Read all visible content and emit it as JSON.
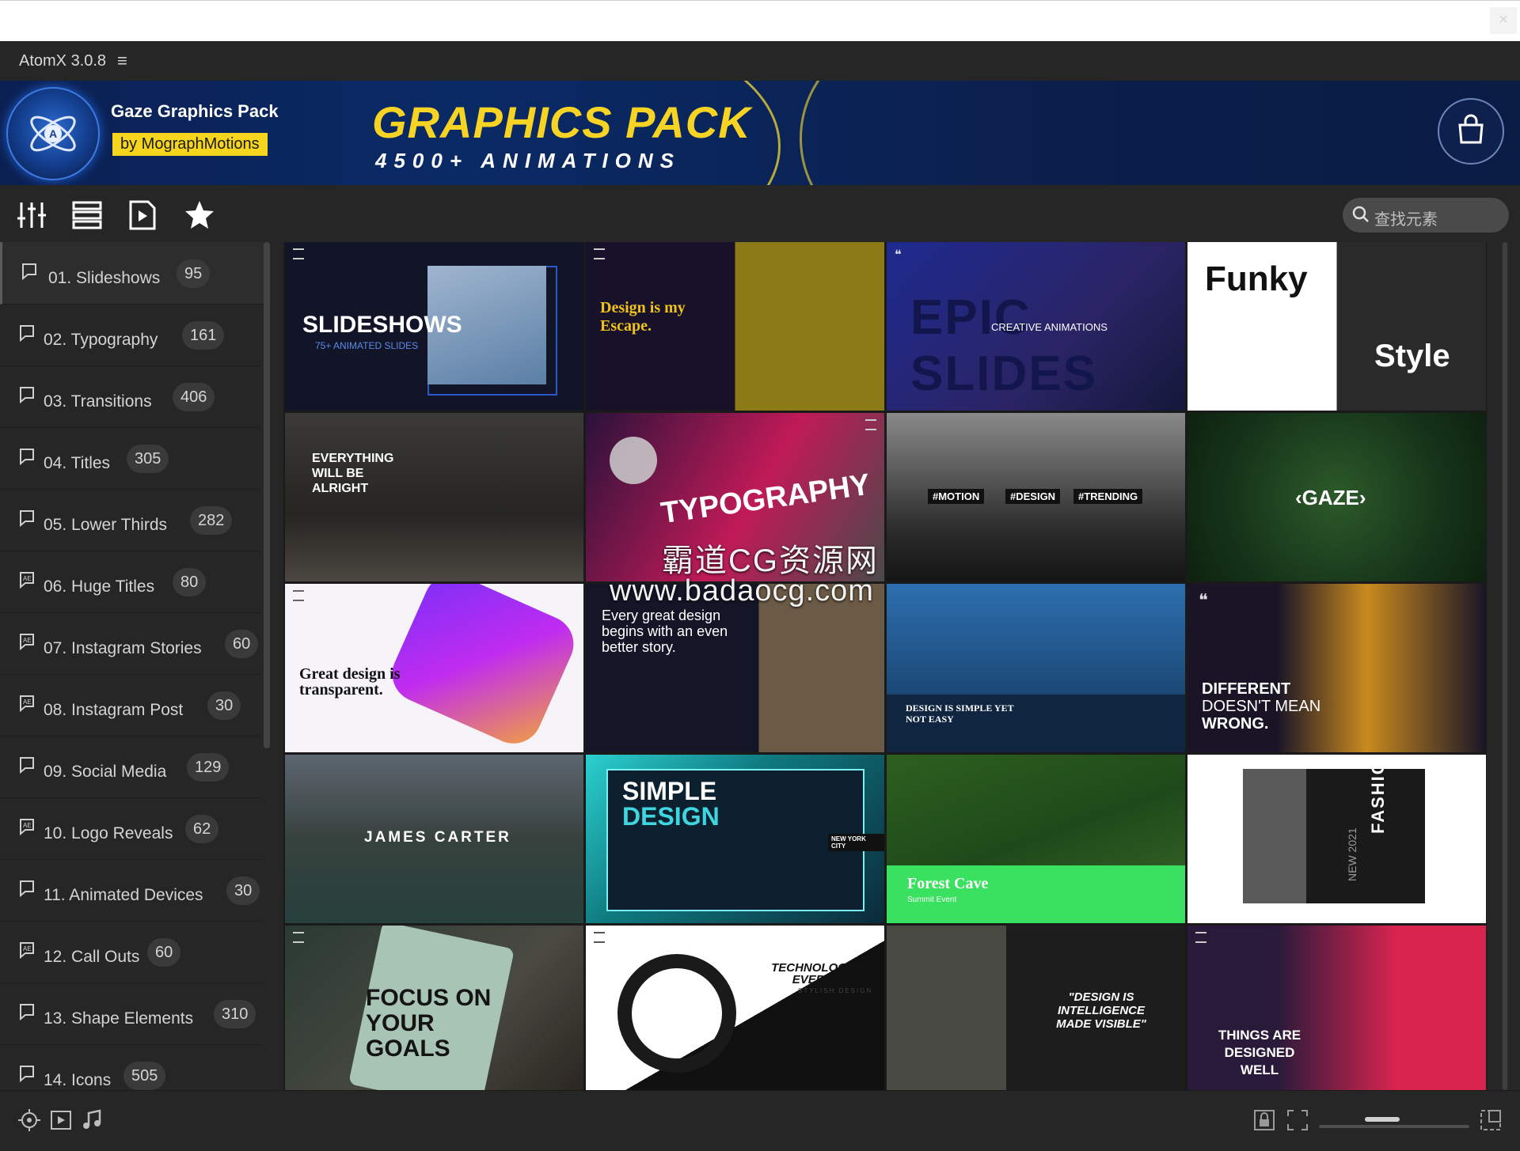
{
  "app": {
    "title": "AtomX 3.0.8",
    "menu_icon": "hamburger-icon"
  },
  "banner": {
    "pack_name": "Gaze Graphics Pack",
    "by_line": "by MographMotions",
    "headline": "GRAPHICS PACK",
    "subline": "4500+ ANIMATIONS",
    "colors": {
      "yellow": "#f7d324",
      "navy": "#0b2052"
    }
  },
  "toolbar": {
    "icons": [
      "sliders-icon",
      "list-icon",
      "play-file-icon",
      "star-icon"
    ],
    "search_placeholder": "查找元素"
  },
  "sidebar": {
    "categories": [
      {
        "label": "01. Slideshows",
        "count": "95"
      },
      {
        "label": "02. Typography",
        "count": "161"
      },
      {
        "label": "03. Transitions",
        "count": "406"
      },
      {
        "label": "04. Titles",
        "count": "305"
      },
      {
        "label": "05. Lower Thirds",
        "count": "282"
      },
      {
        "label": "06. Huge Titles",
        "count": "80"
      },
      {
        "label": "07. Instagram Stories",
        "count": "60"
      },
      {
        "label": "08. Instagram Post",
        "count": "30"
      },
      {
        "label": "09. Social Media",
        "count": "129"
      },
      {
        "label": "10. Logo Reveals",
        "count": "62"
      },
      {
        "label": "11. Animated Devices",
        "count": "30"
      },
      {
        "label": "12. Call Outs",
        "count": "60"
      },
      {
        "label": "13. Shape Elements",
        "count": "310"
      },
      {
        "label": "14. Icons",
        "count": "505"
      }
    ]
  },
  "tiles": [
    {
      "text": "SLIDESHOWS",
      "sub": "75+ ANIMATED SLIDES"
    },
    {
      "text": "Design is my Escape."
    },
    {
      "text": "EPIC SLIDES",
      "sub": "CREATIVE ANIMATIONS"
    },
    {
      "text": "Funky",
      "sub": "Style"
    },
    {
      "text": "EVERYTHING WILL BE ALRIGHT"
    },
    {
      "text": "TYPOGRAPHY"
    },
    {
      "tags": [
        "#MOTION",
        "#DESIGN",
        "#TRENDING"
      ]
    },
    {
      "text": "‹GAZE›"
    },
    {
      "text": "Great design is transparent."
    },
    {
      "text": "Every great design begins with an even better story."
    },
    {
      "text": "DESIGN IS SIMPLE YET NOT EASY"
    },
    {
      "text": "DIFFERENT",
      "sub": "DOESN'T MEAN",
      "sub2": "WRONG."
    },
    {
      "text": "JAMES CARTER"
    },
    {
      "text": "SIMPLE",
      "sub": "DESIGN",
      "sub2": "NEW YORK CITY"
    },
    {
      "text": "Forest Cave",
      "sub": "Summit Event"
    },
    {
      "text": "FASHION",
      "sub": "NEW 2021"
    },
    {
      "text": "FOCUS ON YOUR GOALS"
    },
    {
      "text": "TECHNOLOGY IS EVERYTHING",
      "sub": "STYLISH DESIGN"
    },
    {
      "text": "\"DESIGN IS INTELLIGENCE MADE VISIBLE\""
    },
    {
      "text": "THINGS ARE DESIGNED WELL"
    }
  ],
  "watermark": {
    "line1": "霸道CG资源网",
    "line2": "www.badaocg.com"
  },
  "statusbar": {
    "icons": [
      "target-icon",
      "video-icon",
      "music-icon",
      "lock-icon",
      "fit-icon",
      "expand-icon"
    ]
  }
}
